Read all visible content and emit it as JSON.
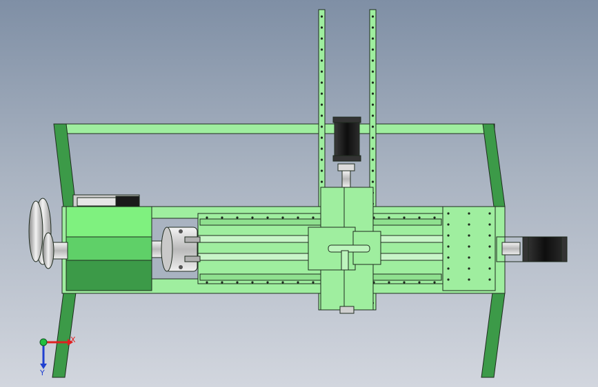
{
  "triad": {
    "x_label": "X",
    "y_label": "Y",
    "x_color": "#e02020",
    "y_color": "#2040d0",
    "origin_color": "#20c040"
  },
  "colors": {
    "background_top": "#7f8fa5",
    "background_bottom": "#d2d6de",
    "frame_green": "#9fee9f",
    "dark_green": "#3c9a48",
    "spindle_green": "#5fd068",
    "metal": "#d8d8d8",
    "motor_black": "#1a1a1a",
    "outline": "#1e2a1e"
  },
  "icons": [
    "axis-triad-icon",
    "stepper-motor-icon",
    "chuck-icon",
    "pulley-icon"
  ]
}
